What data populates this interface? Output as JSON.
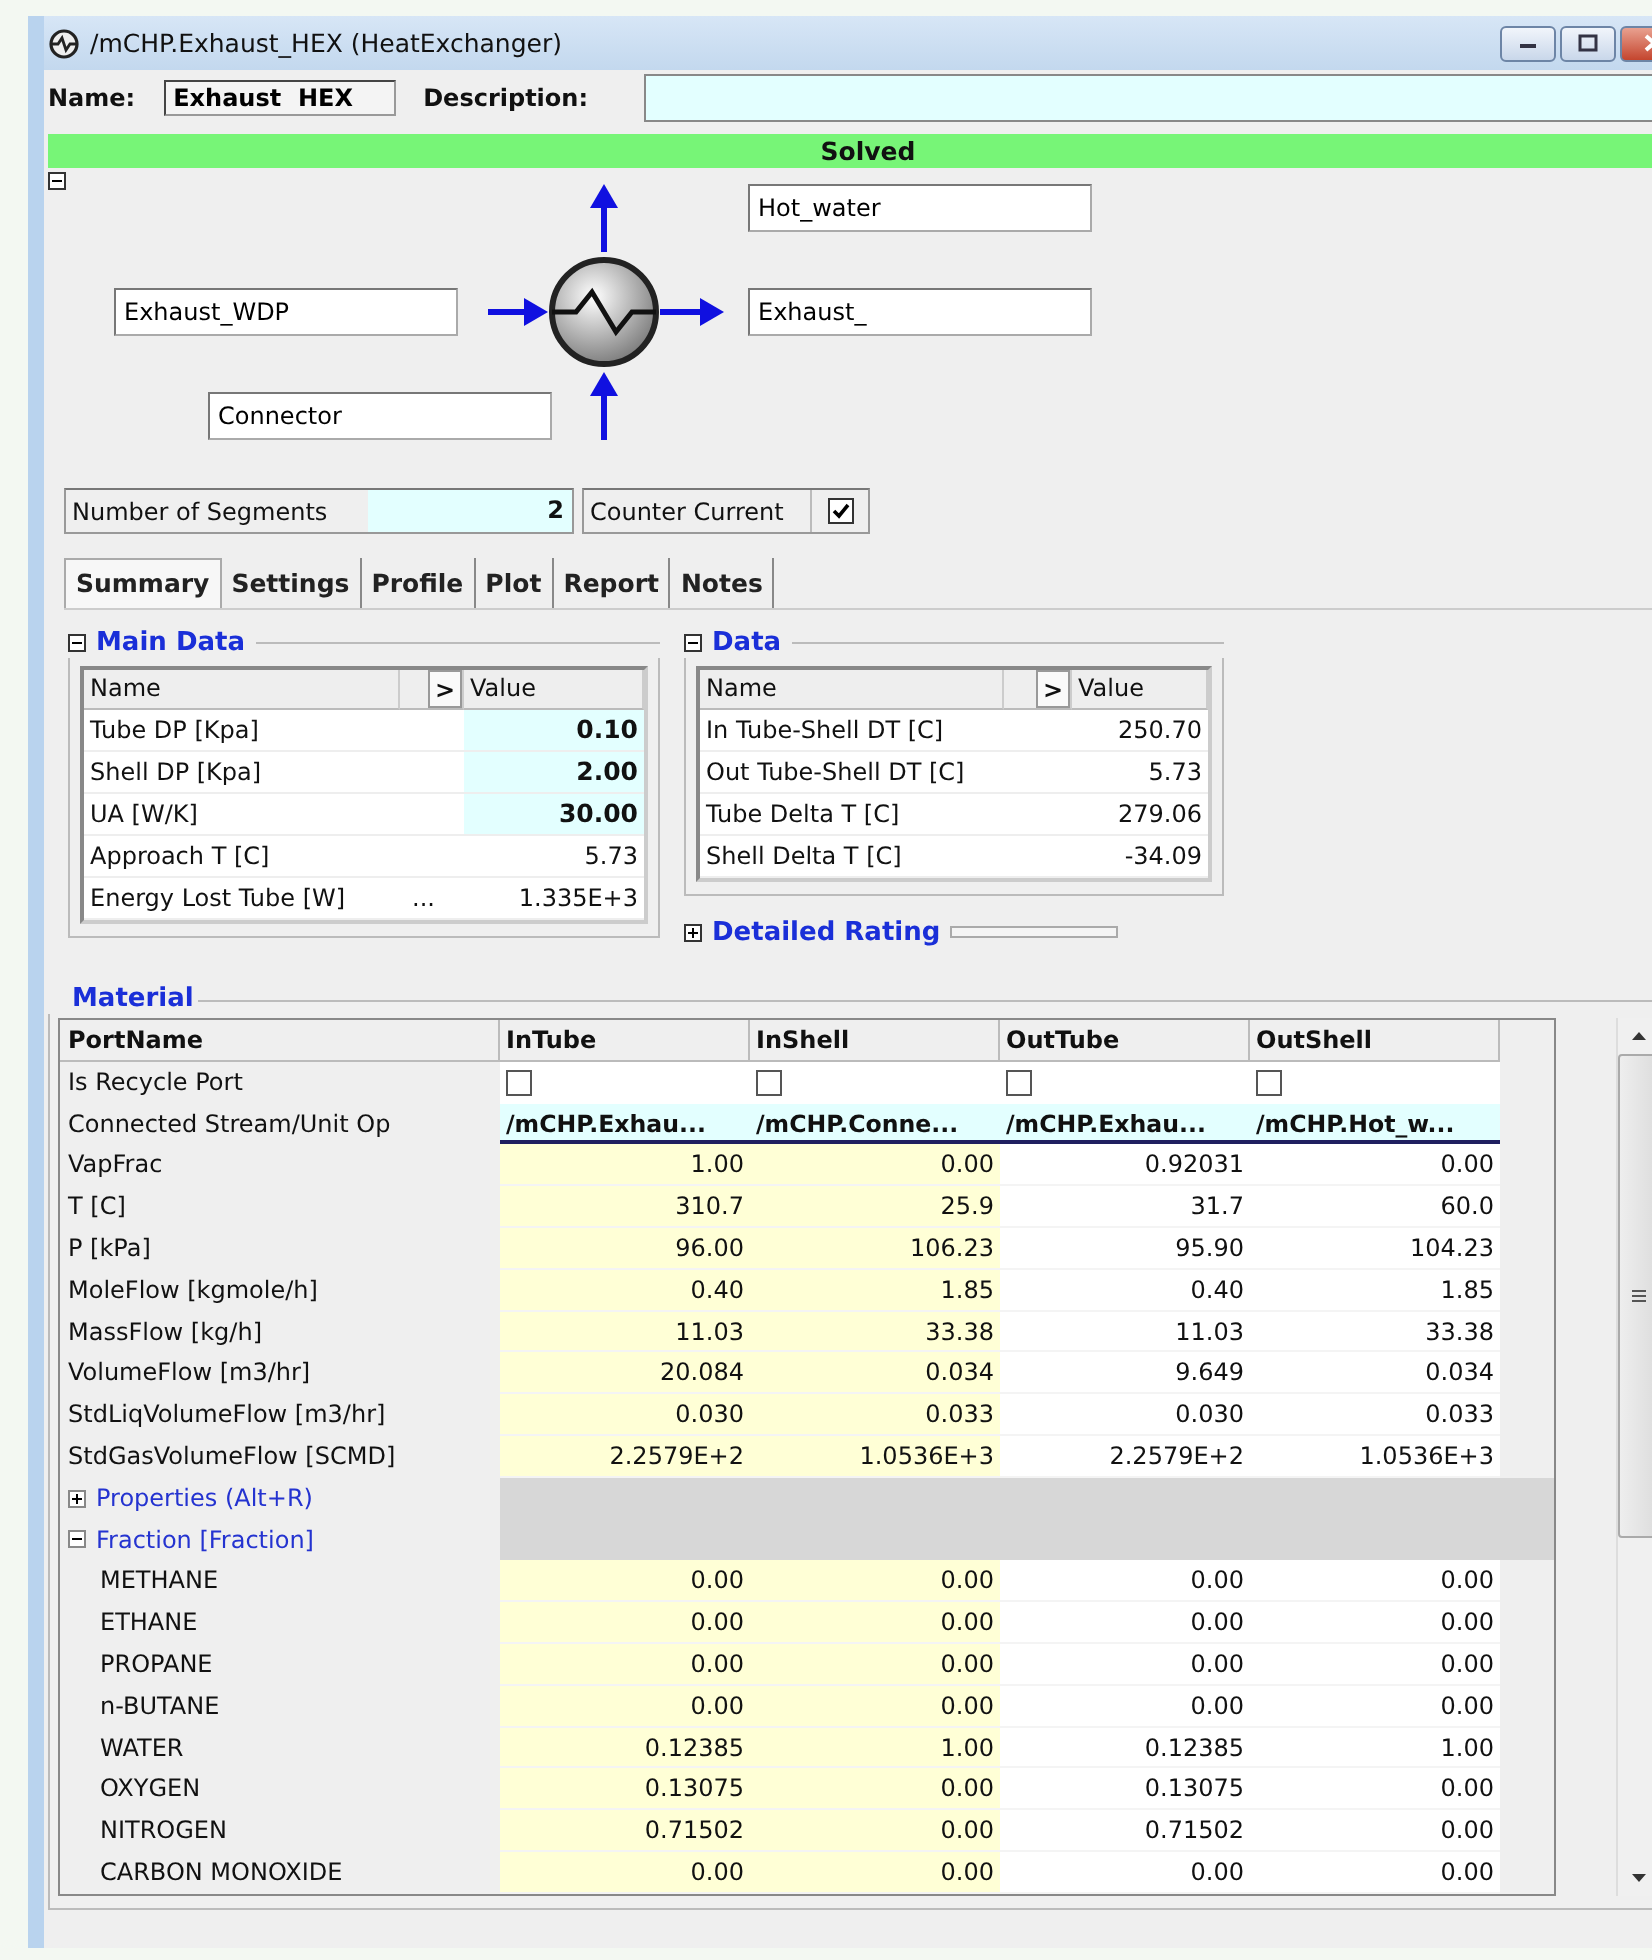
{
  "window": {
    "title": "/mCHP.Exhaust_HEX (HeatExchanger)"
  },
  "header": {
    "name_label": "Name:",
    "name_value": "Exhaust  HEX",
    "description_label": "Description:"
  },
  "status": {
    "text": "Solved",
    "kind": "solved"
  },
  "diagram": {
    "expanded": true,
    "streams": {
      "top": "Hot_water",
      "left": "Exhaust_WDP",
      "right": "Exhaust_",
      "bottom": "Connector"
    }
  },
  "segments": {
    "label": "Number of Segments",
    "value": "2",
    "counter_current_label": "Counter Current",
    "counter_current": true
  },
  "tabs": [
    {
      "label": "Summary",
      "selected": true
    },
    {
      "label": "Settings",
      "selected": false
    },
    {
      "label": "Profile",
      "selected": false
    },
    {
      "label": "Plot",
      "selected": false
    },
    {
      "label": "Report",
      "selected": false
    },
    {
      "label": "Notes",
      "selected": false
    }
  ],
  "main_data": {
    "title": "Main Data",
    "expanded": true,
    "columns": [
      "Name",
      ">",
      "Value"
    ],
    "rows": [
      {
        "name": "Tube DP [Kpa]",
        "value": "0.10",
        "kind": "input"
      },
      {
        "name": "Shell DP [Kpa]",
        "value": "2.00",
        "kind": "input"
      },
      {
        "name": "UA [W/K]",
        "value": "30.00",
        "kind": "input"
      },
      {
        "name": "Approach T [C]",
        "value": "5.73",
        "kind": "calc"
      },
      {
        "name": "Energy Lost Tube [W]",
        "extra": "...",
        "value": "1.335E+3",
        "kind": "calc"
      }
    ]
  },
  "data": {
    "title": "Data",
    "expanded": true,
    "columns": [
      "Name",
      ">",
      "Value"
    ],
    "rows": [
      {
        "name": "In Tube-Shell DT [C]",
        "value": "250.70"
      },
      {
        "name": "Out Tube-Shell DT [C]",
        "value": "5.73"
      },
      {
        "name": "Tube Delta T [C]",
        "value": "279.06"
      },
      {
        "name": "Shell Delta T [C]",
        "value": "-34.09"
      }
    ]
  },
  "detailed_rating": {
    "title": "Detailed Rating",
    "expanded": false
  },
  "material": {
    "title": "Material",
    "columns": [
      {
        "label": "PortName"
      },
      {
        "label": "InTube",
        "inlet": true
      },
      {
        "label": "InShell",
        "inlet": true
      },
      {
        "label": "OutTube",
        "inlet": false
      },
      {
        "label": "OutShell",
        "inlet": false
      }
    ],
    "rows": [
      {
        "kind": "checks",
        "name": "Is Recycle Port",
        "checked": [
          false,
          false,
          false,
          false
        ]
      },
      {
        "kind": "links",
        "name": "Connected Stream/Unit Op",
        "values": [
          "/mCHP.Exhau...",
          "/mCHP.Conne...",
          "/mCHP.Exhau...",
          "/mCHP.Hot_w..."
        ]
      },
      {
        "kind": "values",
        "name": "VapFrac",
        "values": [
          "1.00",
          "0.00",
          "0.92031",
          "0.00"
        ]
      },
      {
        "kind": "values",
        "name": "T [C]",
        "values": [
          "310.7",
          "25.9",
          "31.7",
          "60.0"
        ]
      },
      {
        "kind": "values",
        "name": "P [kPa]",
        "values": [
          "96.00",
          "106.23",
          "95.90",
          "104.23"
        ]
      },
      {
        "kind": "values",
        "name": "MoleFlow [kgmole/h]",
        "values": [
          "0.40",
          "1.85",
          "0.40",
          "1.85"
        ]
      },
      {
        "kind": "values",
        "name": "MassFlow [kg/h]",
        "values": [
          "11.03",
          "33.38",
          "11.03",
          "33.38"
        ]
      },
      {
        "kind": "values",
        "name": "VolumeFlow [m3/hr]",
        "values": [
          "20.084",
          "0.034",
          "9.649",
          "0.034"
        ]
      },
      {
        "kind": "values",
        "name": "StdLiqVolumeFlow [m3/hr]",
        "values": [
          "0.030",
          "0.033",
          "0.030",
          "0.033"
        ]
      },
      {
        "kind": "values",
        "name": "StdGasVolumeFlow [SCMD]",
        "values": [
          "2.2579E+2",
          "1.0536E+3",
          "2.2579E+2",
          "1.0536E+3"
        ]
      },
      {
        "kind": "group",
        "name": "Properties  (Alt+R)",
        "expanded": false
      },
      {
        "kind": "group",
        "name": "Fraction [Fraction]",
        "expanded": true
      },
      {
        "kind": "component",
        "name": "METHANE",
        "values": [
          "0.00",
          "0.00",
          "0.00",
          "0.00"
        ]
      },
      {
        "kind": "component",
        "name": "ETHANE",
        "values": [
          "0.00",
          "0.00",
          "0.00",
          "0.00"
        ]
      },
      {
        "kind": "component",
        "name": "PROPANE",
        "values": [
          "0.00",
          "0.00",
          "0.00",
          "0.00"
        ]
      },
      {
        "kind": "component",
        "name": "n-BUTANE",
        "values": [
          "0.00",
          "0.00",
          "0.00",
          "0.00"
        ]
      },
      {
        "kind": "component",
        "name": "WATER",
        "values": [
          "0.12385",
          "1.00",
          "0.12385",
          "1.00"
        ]
      },
      {
        "kind": "component",
        "name": "OXYGEN",
        "values": [
          "0.13075",
          "0.00",
          "0.13075",
          "0.00"
        ]
      },
      {
        "kind": "component",
        "name": "NITROGEN",
        "values": [
          "0.71502",
          "0.00",
          "0.71502",
          "0.00"
        ]
      },
      {
        "kind": "component",
        "name": "CARBON MONOXIDE",
        "values": [
          "0.00",
          "0.00",
          "0.00",
          "0.00"
        ]
      }
    ]
  }
}
